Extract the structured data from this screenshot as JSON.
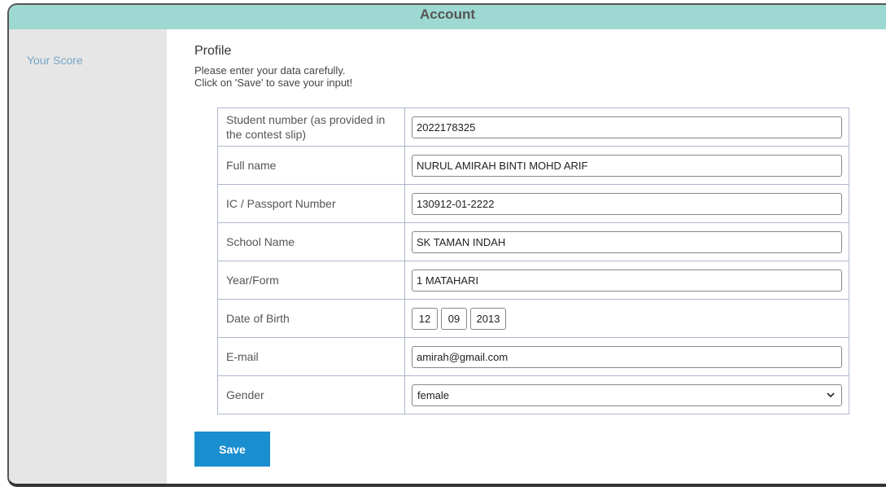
{
  "header": {
    "title": "Account"
  },
  "sidebar": {
    "items": [
      {
        "label": "Your Score"
      }
    ]
  },
  "profile": {
    "title": "Profile",
    "instruction_line1": "Please enter your data carefully.",
    "instruction_line2": "Click on 'Save' to save your input!"
  },
  "form": {
    "student_number": {
      "label": "Student number (as provided in the contest slip)",
      "value": "2022178325"
    },
    "full_name": {
      "label": "Full name",
      "value": "NURUL AMIRAH BINTI MOHD ARIF"
    },
    "ic_passport": {
      "label": "IC / Passport Number",
      "value": "130912-01-2222"
    },
    "school_name": {
      "label": "School Name",
      "value": "SK TAMAN INDAH"
    },
    "year_form": {
      "label": "Year/Form",
      "value": "1 MATAHARI"
    },
    "date_of_birth": {
      "label": "Date of Birth",
      "day": "12",
      "month": "09",
      "year": "2013"
    },
    "email": {
      "label": "E-mail",
      "value": "amirah@gmail.com"
    },
    "gender": {
      "label": "Gender",
      "value": "female"
    }
  },
  "actions": {
    "save_label": "Save"
  },
  "colors": {
    "header_bg": "#9dd9d2",
    "sidebar_bg": "#e6e6e6",
    "save_button": "#1b8ed0",
    "link": "#77a6c8"
  },
  "icons": {
    "select_arrow": "chevron-down-icon"
  }
}
